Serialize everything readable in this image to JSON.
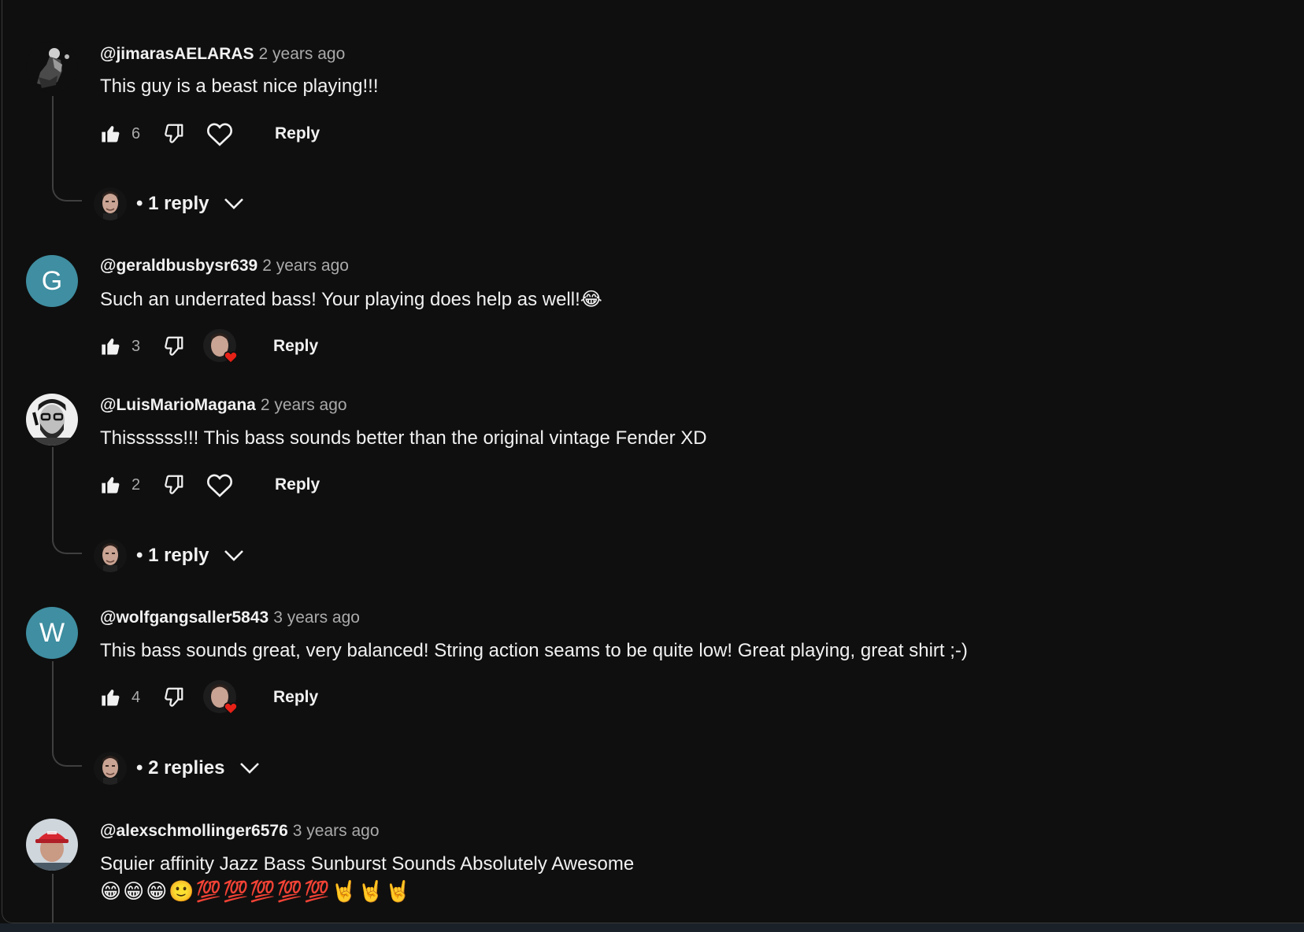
{
  "comments": [
    {
      "author": "@jimarasAELARAS",
      "time": "2 years ago",
      "text": "This guy is a beast nice playing!!!",
      "likes": "6",
      "reply_label": "Reply",
      "creator_hearted": false,
      "avatar": {
        "type": "image",
        "icon": "dark-figure-avatar"
      },
      "replies_label": "1 reply"
    },
    {
      "author": "@geraldbusbysr639",
      "time": "2 years ago",
      "text": "Such an underrated bass! Your playing does help as well!😂",
      "likes": "3",
      "reply_label": "Reply",
      "creator_hearted": true,
      "avatar": {
        "type": "letter",
        "letter": "G",
        "color": "#3f8ea1"
      }
    },
    {
      "author": "@LuisMarioMagana",
      "time": "2 years ago",
      "text": "Thissssss!!! This bass sounds better than the original vintage Fender XD",
      "likes": "2",
      "reply_label": "Reply",
      "creator_hearted": false,
      "avatar": {
        "type": "image",
        "icon": "bearded-man-avatar"
      },
      "replies_label": "1 reply"
    },
    {
      "author": "@wolfgangsaller5843",
      "time": "3 years ago",
      "text": "This bass sounds great, very balanced! String action seams to be quite low! Great playing, great shirt ;-)",
      "likes": "4",
      "reply_label": "Reply",
      "creator_hearted": true,
      "avatar": {
        "type": "letter",
        "letter": "W",
        "color": "#3f8ea1"
      },
      "replies_label": "2 replies"
    },
    {
      "author": "@alexschmollinger6576",
      "time": "3 years ago",
      "text": "Squier affinity Jazz Bass Sunburst Sounds Absolutely Awesome",
      "emoji_line": "😁😁😁🙂💯💯💯💯💯🤘🤘🤘",
      "avatar": {
        "type": "image",
        "icon": "red-cap-man-avatar"
      }
    }
  ],
  "colors": {
    "background": "#0f0f0f",
    "primary_text": "#f1f1f1",
    "secondary_text": "#aaaaaa",
    "heart_red": "#e62117",
    "letter_avatar": "#3f8ea1"
  }
}
